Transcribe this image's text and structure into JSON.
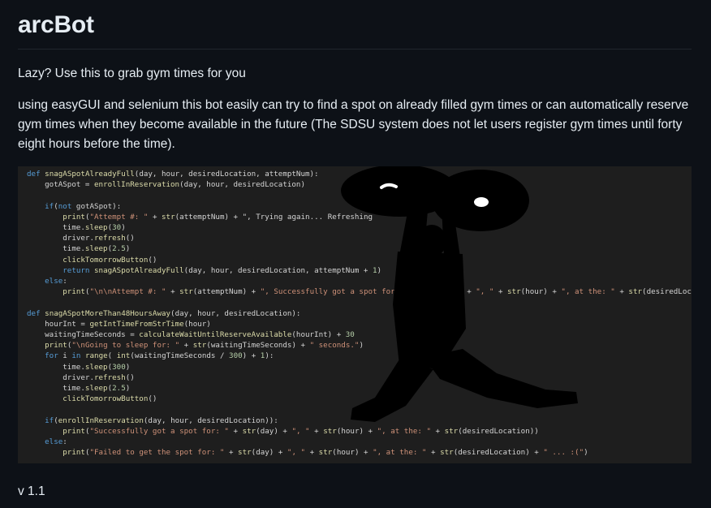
{
  "readme": {
    "title": "arcBot",
    "tagline": "Lazy? Use this to grab gym times for you",
    "description": "using easyGUI and selenium this bot easily can try to find a spot on already filled gym times or can automatically reserve gym times when they become available in the future (The SDSU system does not let users register gym times until forty eight hours before the time).",
    "version": "v 1.1"
  },
  "screenshot": {
    "code_lines": [
      "def snagASpotAlreadyFull(day, hour, desiredLocation, attemptNum):",
      "    gotASpot = enrollInReservation(day, hour, desiredLocation)",
      "",
      "    if(not gotASpot):",
      "        print(\"Attempt #: \" + str(attemptNum) + \", Trying again... Refreshing                 30 se",
      "        time.sleep(30)",
      "        driver.refresh()",
      "        time.sleep(2.5)",
      "        clickTomorrowButton()",
      "        return snagASpotAlreadyFull(day, hour, desiredLocation, attemptNum + 1)",
      "    else:",
      "        print(\"\\n\\nAttempt #: \" + str(attemptNum) + \", Successfully got a spot for: \"             + \", \" + str(hour) + \", at the: \" + str(desiredLocation))",
      "",
      "def snagASpotMoreThan48HoursAway(day, hour, desiredLocation):",
      "    hourInt = getIntTimeFromStrTime(hour)",
      "    waitingTimeSeconds = calculateWaitUntilReserveAvailable(hourInt) + 30",
      "    print(\"\\nGoing to sleep for: \" + str(waitingTimeSeconds) + \" seconds.\")",
      "    for i in range( int(waitingTimeSeconds / 300) + 1):",
      "        time.sleep(300)",
      "        driver.refresh()",
      "        time.sleep(2.5)",
      "        clickTomorrowButton()",
      "",
      "    if(enrollInReservation(day, hour, desiredLocation)):",
      "        print(\"Successfully got a spot for: \" + str(day) + \", \" + str(hour) + \", at the: \" + str(desiredLocation))",
      "    else:",
      "        print(\"Failed to get the spot for: \" + str(day) + \", \" + str(hour) + \", at the: \" + str(desiredLocation) + \" ... :(\")"
    ]
  },
  "colors": {
    "background": "#0d1117",
    "text": "#e6edf3",
    "code_bg": "#1e1e1e"
  }
}
